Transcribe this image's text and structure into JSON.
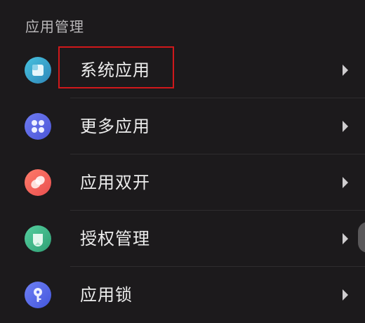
{
  "section": {
    "title": "应用管理"
  },
  "items": [
    {
      "label": "系统应用",
      "icon": "system-apps-icon",
      "color": "#3aa7c6"
    },
    {
      "label": "更多应用",
      "icon": "more-apps-icon",
      "color": "#5d6ce8"
    },
    {
      "label": "应用双开",
      "icon": "app-clone-icon",
      "color": "#f06a5e"
    },
    {
      "label": "授权管理",
      "icon": "authorization-icon",
      "color": "#3fba8c"
    },
    {
      "label": "应用锁",
      "icon": "app-lock-icon",
      "color": "#5b6ef0"
    }
  ],
  "highlight": {
    "color": "#d0181b",
    "target": "系统应用"
  }
}
